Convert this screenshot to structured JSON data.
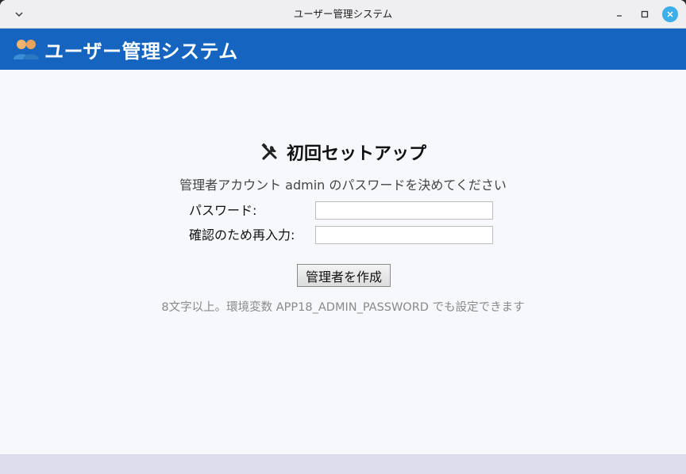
{
  "window": {
    "title": "ユーザー管理システム",
    "controls": {
      "menu_icon": "chevron-down-icon",
      "minimize_icon": "minimize-icon",
      "maximize_icon": "maximize-icon",
      "close_icon": "close-icon"
    }
  },
  "header": {
    "icon": "users-icon",
    "title": "ユーザー管理システム",
    "color": "#1565c0"
  },
  "setup": {
    "icon": "tools-icon",
    "heading": "初回セットアップ",
    "description": "管理者アカウント admin のパスワードを決めてください",
    "password_label": "パスワード:",
    "password_value": "",
    "confirm_label": "確認のため再入力:",
    "confirm_value": "",
    "submit_label": "管理者を作成",
    "hint": "8文字以上。環境変数 APP18_ADMIN_PASSWORD でも設定できます"
  }
}
